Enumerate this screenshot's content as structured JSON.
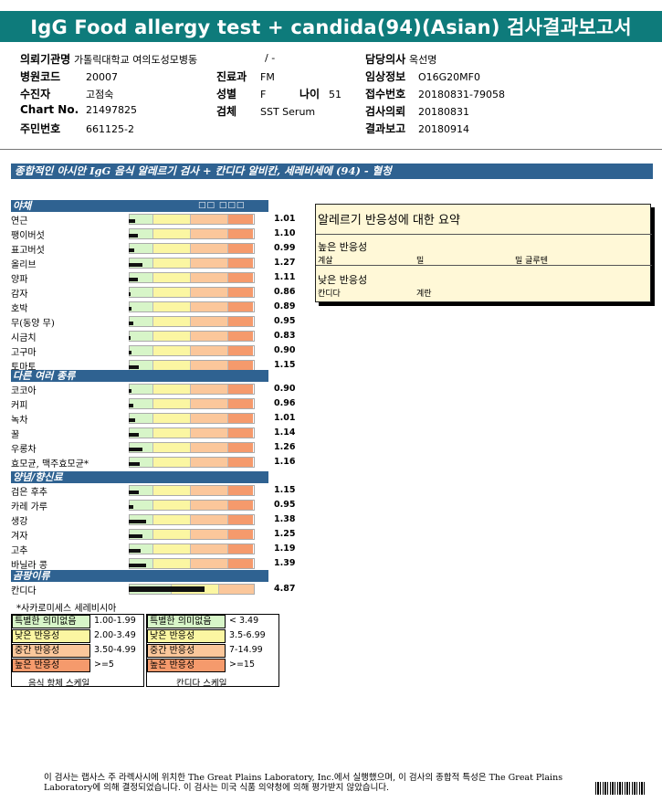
{
  "header": {
    "title": "IgG Food allergy test + candida(94)(Asian) 검사결과보고서"
  },
  "info": {
    "inst_label": "의뢰기관명",
    "inst_value": "가톨릭대학교 여의도성모병동",
    "ward_value": "/ -",
    "doctor_label": "담당의사",
    "doctor_value": "옥선명",
    "hospcode_label": "병원코드",
    "hospcode_value": "20007",
    "dept_label": "진료과",
    "dept_value": "FM",
    "clinical_label": "임상정보",
    "clinical_value": "O16G20MF0",
    "patient_label": "수진자",
    "patient_value": "고점숙",
    "sex_label": "성별",
    "sex_value": "F",
    "age_label": "나이",
    "age_value": "51",
    "receipt_label": "접수번호",
    "receipt_value": "20180831-79058",
    "chart_label": "Chart No.",
    "chart_value": "21497825",
    "specimen_label": "검체",
    "specimen_value": "SST Serum",
    "request_label": "검사의뢰",
    "request_value": "20180831",
    "id_label": "주민번호",
    "id_value": "661125-2",
    "report_label": "결과보고",
    "report_value": "20180914"
  },
  "section_title": "종합적인 아시안 IgG 음식 알레르기 검사 + 칸디다 알비칸, 세레비세에 (94) - 혈청",
  "scale_header": "□□ □□□",
  "categories": [
    {
      "name": "야채",
      "items": [
        {
          "food": "연근",
          "value": "1.01",
          "level": 1.01
        },
        {
          "food": "팽이버섯",
          "value": "1.10",
          "level": 1.1
        },
        {
          "food": "표고버섯",
          "value": "0.99",
          "level": 0.99
        },
        {
          "food": "올리브",
          "value": "1.27",
          "level": 1.27
        },
        {
          "food": "양파",
          "value": "1.11",
          "level": 1.11
        },
        {
          "food": "감자",
          "value": "0.86",
          "level": 0.86
        },
        {
          "food": "호박",
          "value": "0.89",
          "level": 0.89
        },
        {
          "food": "무(동양 무)",
          "value": "0.95",
          "level": 0.95
        },
        {
          "food": "시금치",
          "value": "0.83",
          "level": 0.83
        },
        {
          "food": "고구마",
          "value": "0.90",
          "level": 0.9
        },
        {
          "food": "토마토",
          "value": "1.15",
          "level": 1.15
        }
      ]
    },
    {
      "name": "다른 여러 종류",
      "items": [
        {
          "food": "코코아",
          "value": "0.90",
          "level": 0.9
        },
        {
          "food": "커피",
          "value": "0.96",
          "level": 0.96
        },
        {
          "food": "녹차",
          "value": "1.01",
          "level": 1.01
        },
        {
          "food": "꿀",
          "value": "1.14",
          "level": 1.14
        },
        {
          "food": "우롱차",
          "value": "1.26",
          "level": 1.26
        },
        {
          "food": "효모균, 맥주효모균*",
          "value": "1.16",
          "level": 1.16
        }
      ]
    },
    {
      "name": "양념/향신료",
      "items": [
        {
          "food": "검은 후추",
          "value": "1.15",
          "level": 1.15
        },
        {
          "food": "카레 가루",
          "value": "0.95",
          "level": 0.95
        },
        {
          "food": "생강",
          "value": "1.38",
          "level": 1.38
        },
        {
          "food": "겨자",
          "value": "1.25",
          "level": 1.25
        },
        {
          "food": "고추",
          "value": "1.19",
          "level": 1.19
        },
        {
          "food": "바닐라 콩",
          "value": "1.39",
          "level": 1.39
        }
      ]
    },
    {
      "name": "곰팡이류",
      "items": [
        {
          "food": "칸디다",
          "value": "4.87",
          "level": 4.87,
          "candida": true
        }
      ]
    }
  ],
  "footnote": "*사카로미세스 세레비시아",
  "food_scale": {
    "caption": "음식 항체 스케일",
    "rows": [
      {
        "label": "특별한 의미없음",
        "range": "1.00-1.99",
        "color": "#d7f5c8"
      },
      {
        "label": "낮은 반응성",
        "range": "2.00-3.49",
        "color": "#fbf6a2"
      },
      {
        "label": "중간 반응성",
        "range": "3.50-4.99",
        "color": "#fbc79b"
      },
      {
        "label": "높은 반응성",
        "range": ">=5",
        "color": "#f59a6c"
      }
    ]
  },
  "candida_scale": {
    "caption": "칸디다 스케일",
    "rows": [
      {
        "label": "특별한 의미없음",
        "range": "< 3.49",
        "color": "#d7f5c8"
      },
      {
        "label": "낮은 반응성",
        "range": "3.5-6.99",
        "color": "#fbf6a2"
      },
      {
        "label": "중간 반응성",
        "range": "7-14.99",
        "color": "#fbc79b"
      },
      {
        "label": "높은 반응성",
        "range": ">=15",
        "color": "#f59a6c"
      }
    ]
  },
  "summary": {
    "title": "알레르기 반응성에 대한 요약",
    "high_label": "높은 반응성",
    "high_items": [
      "계살",
      "밀",
      "밀 글루텐"
    ],
    "low_label": "낮은 반응성",
    "low_items": [
      "칸디다",
      "계란"
    ]
  },
  "footer": "이 검사는 랩사스 주 라렉사시에 위치한 The Great Plains Laboratory, Inc.에서 실행했으며, 이 검사의 종합적 특성은 The Great Plains Laboratory에 의해 결정되었습니다. 이 검사는 미국 식품 의약청에 의해 평가받지 않았습니다.",
  "colors": {
    "title_bg": "#0e7b7b",
    "bar_blue": "#2f6291",
    "none": "#d7f5c8",
    "low": "#fbf6a2",
    "mid": "#fbc79b",
    "high": "#f59a6c"
  }
}
